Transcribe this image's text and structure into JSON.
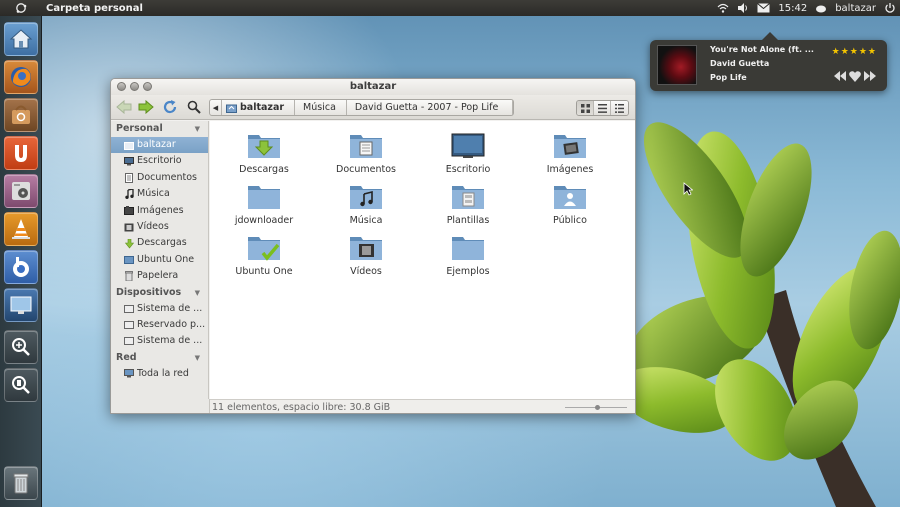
{
  "top_panel": {
    "app_title": "Carpeta personal",
    "time": "15:42",
    "user": "baltazar"
  },
  "sound_menu": {
    "song": "You're Not Alone (ft. ...",
    "artist": "David Guetta",
    "album": "Pop Life",
    "rating": "★★★★★"
  },
  "window": {
    "title": "baltazar",
    "pathbar": [
      "baltazar",
      "Música",
      "David Guetta - 2007 - Pop Life"
    ],
    "sidebar": {
      "personal_header": "Personal",
      "personal": [
        "baltazar",
        "Escritorio",
        "Documentos",
        "Música",
        "Imágenes",
        "Vídeos",
        "Descargas",
        "Ubuntu One",
        "Papelera"
      ],
      "devices_header": "Dispositivos",
      "devices": [
        "Sistema de ...",
        "Reservado p...",
        "Sistema de ..."
      ],
      "network_header": "Red",
      "network": [
        "Toda la red"
      ]
    },
    "folders": [
      "Descargas",
      "Documentos",
      "Escritorio",
      "Imágenes",
      "jdownloader",
      "Música",
      "Plantillas",
      "Público",
      "Ubuntu One",
      "Vídeos",
      "Ejemplos"
    ],
    "status": "11 elementos, espacio libre: 30.8 GiB"
  },
  "colors": {
    "panel": "#2b2a27",
    "launcher": "#2d3a40",
    "selection": "#7aa1c6",
    "folder_blue": "#5f8cb8"
  }
}
